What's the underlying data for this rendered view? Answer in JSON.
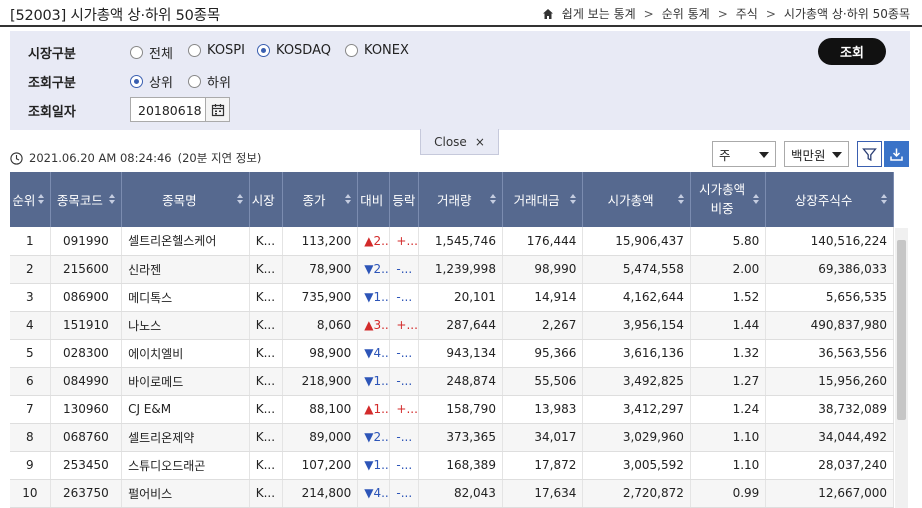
{
  "header": {
    "title": "[52003] 시가총액 상·하위 50종목",
    "breadcrumb": [
      "쉽게 보는 통계",
      "순위 통계",
      "주식",
      "시가총액 상·하위 50종목"
    ]
  },
  "search": {
    "market_label": "시장구분",
    "market_options": [
      "전체",
      "KOSPI",
      "KOSDAQ",
      "KONEX"
    ],
    "market_selected": "KOSDAQ",
    "query_label": "조회구분",
    "query_options": [
      "상위",
      "하위"
    ],
    "query_selected": "상위",
    "date_label": "조회일자",
    "date_value": "20180618",
    "search_button": "조회",
    "close_label": "Close"
  },
  "status": {
    "timestamp": "2021.06.20 AM 08:24:46",
    "delay_note": "(20분 지연 정보)",
    "period_select": "주",
    "unit_select": "백만원"
  },
  "colors": {
    "header_bg": "#56698f",
    "panel_bg": "#e8eaf5",
    "up": "#d32b2b",
    "down": "#2d55b8"
  },
  "table": {
    "columns": [
      "순위",
      "종목코드",
      "종목명",
      "시장",
      "종가",
      "대비",
      "등락",
      "거래량",
      "거래대금",
      "시가총액",
      "시가총액\n비중",
      "상장주식수"
    ],
    "rows": [
      [
        "1",
        "091990",
        "셀트리온헬스케어",
        "K...",
        "113,200",
        "▲2...",
        "+...",
        "1,545,746",
        "176,444",
        "15,906,437",
        "5.80",
        "140,516,224"
      ],
      [
        "2",
        "215600",
        "신라젠",
        "K...",
        "78,900",
        "▼2...",
        "-...",
        "1,239,998",
        "98,990",
        "5,474,558",
        "2.00",
        "69,386,033"
      ],
      [
        "3",
        "086900",
        "메디톡스",
        "K...",
        "735,900",
        "▼1...",
        "-...",
        "20,101",
        "14,914",
        "4,162,644",
        "1.52",
        "5,656,535"
      ],
      [
        "4",
        "151910",
        "나노스",
        "K...",
        "8,060",
        "▲3...",
        "+...",
        "287,644",
        "2,267",
        "3,956,154",
        "1.44",
        "490,837,980"
      ],
      [
        "5",
        "028300",
        "에이치엘비",
        "K...",
        "98,900",
        "▼4...",
        "-...",
        "943,134",
        "95,366",
        "3,616,136",
        "1.32",
        "36,563,556"
      ],
      [
        "6",
        "084990",
        "바이로메드",
        "K...",
        "218,900",
        "▼1...",
        "-...",
        "248,874",
        "55,506",
        "3,492,825",
        "1.27",
        "15,956,260"
      ],
      [
        "7",
        "130960",
        "CJ E&M",
        "K...",
        "88,100",
        "▲1...",
        "+...",
        "158,790",
        "13,983",
        "3,412,297",
        "1.24",
        "38,732,089"
      ],
      [
        "8",
        "068760",
        "셀트리온제약",
        "K...",
        "89,000",
        "▼2...",
        "-...",
        "373,365",
        "34,017",
        "3,029,960",
        "1.10",
        "34,044,492"
      ],
      [
        "9",
        "253450",
        "스튜디오드래곤",
        "K...",
        "107,200",
        "▼1...",
        "-...",
        "168,389",
        "17,872",
        "3,005,592",
        "1.10",
        "28,037,240"
      ],
      [
        "10",
        "263750",
        "펄어비스",
        "K...",
        "214,800",
        "▼4...",
        "-...",
        "82,043",
        "17,634",
        "2,720,872",
        "0.99",
        "12,667,000"
      ]
    ]
  }
}
